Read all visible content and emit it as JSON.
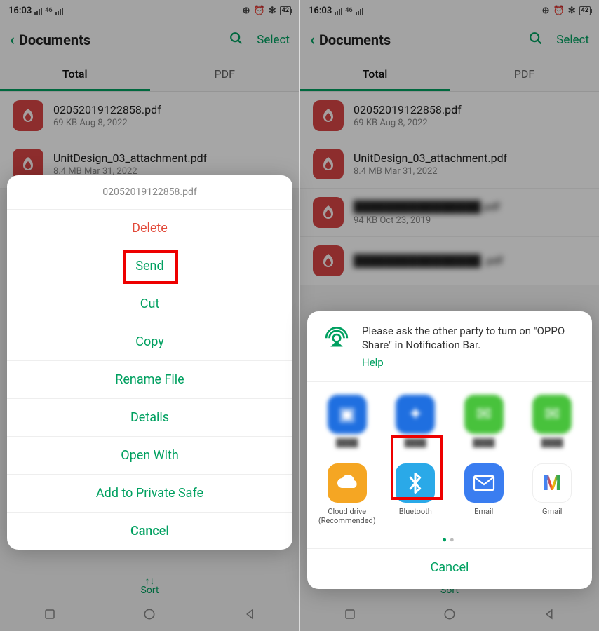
{
  "status": {
    "time": "16:03",
    "battery": "42"
  },
  "header": {
    "title": "Documents",
    "select": "Select"
  },
  "tabs": {
    "total": "Total",
    "pdf": "PDF"
  },
  "files": [
    {
      "name": "02052019122858.pdf",
      "meta": "69 KB   Aug 8, 2022"
    },
    {
      "name": "UnitDesign_03_attachment.pdf",
      "meta": "8.4 MB   Mar 31, 2022"
    },
    {
      "name_blurred": "████████████████ pdf",
      "meta": "94 KB   Oct 23, 2019"
    },
    {
      "name_blurred": "████████████████ .pdf",
      "meta": ""
    }
  ],
  "sort": "Sort",
  "ctx": {
    "title": "02052019122858.pdf",
    "delete": "Delete",
    "send": "Send",
    "cut": "Cut",
    "copy": "Copy",
    "rename": "Rename File",
    "details": "Details",
    "open_with": "Open With",
    "private_safe": "Add to Private Safe",
    "cancel": "Cancel"
  },
  "share": {
    "msg": "Please ask the other party to turn on \"OPPO Share\" in Notification Bar.",
    "help": "Help",
    "apps_row2": {
      "cloud": "Cloud drive (Recommended)",
      "bluetooth": "Bluetooth",
      "email": "Email",
      "gmail": "Gmail"
    },
    "cancel": "Cancel"
  }
}
